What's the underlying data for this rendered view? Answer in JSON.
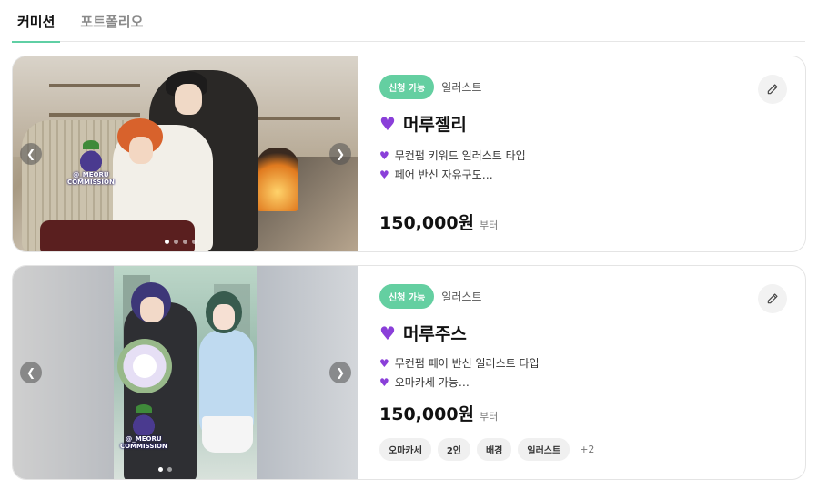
{
  "tabs": [
    {
      "label": "커미션",
      "active": true
    },
    {
      "label": "포트폴리오",
      "active": false
    }
  ],
  "accent_color": "#64cfa1",
  "heart_color": "#8a3fd9",
  "cards": [
    {
      "status": "신청 가능",
      "type": "일러스트",
      "title": "머루젤리",
      "descriptions": [
        "무컨펌 키워드 일러스트 타입",
        "페어 반신 자유구도…"
      ],
      "price": "150,000원",
      "price_suffix": "부터",
      "watermark": "@_MEORU\nCOMMISSION",
      "carousel_dots": 4,
      "active_dot": 1,
      "tags": [],
      "tags_more": ""
    },
    {
      "status": "신청 가능",
      "type": "일러스트",
      "title": "머루주스",
      "descriptions": [
        "무컨펌 페어 반신 일러스트 타입",
        "오마카세 가능…"
      ],
      "price": "150,000원",
      "price_suffix": "부터",
      "watermark": "@_MEORU\nCOMMISSION",
      "carousel_dots": 2,
      "active_dot": 1,
      "tags": [
        "오마카세",
        "2인",
        "배경",
        "일러스트"
      ],
      "tags_more": "+2"
    }
  ],
  "icons": {
    "prev": "chevron-left-icon",
    "next": "chevron-right-icon",
    "edit": "pencil-icon",
    "heart": "purple-heart-icon"
  }
}
